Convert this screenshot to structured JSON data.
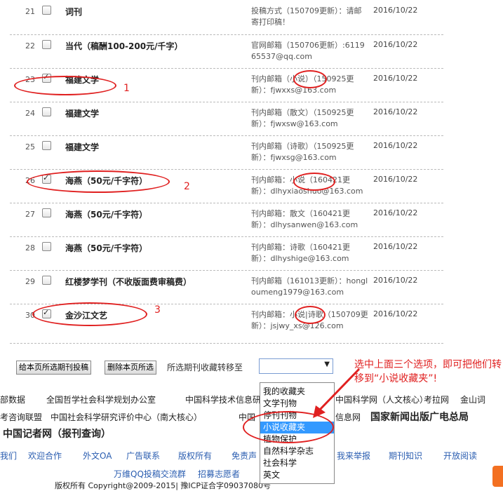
{
  "rows": [
    {
      "num": "21",
      "checked": false,
      "name": "词刊",
      "info": "投稿方式（150709更新）：请邮寄打印稿！",
      "date": "2016/10/22"
    },
    {
      "num": "22",
      "checked": false,
      "name": "当代（稿酬100-200元/千字）",
      "info": "官网邮箱（150706更新）:611965537@qq.com",
      "date": "2016/10/22"
    },
    {
      "num": "23",
      "checked": true,
      "name": "福建文学",
      "info": "刊内邮箱（小说）（150925更新）：fjwxxs@163.com",
      "date": "2016/10/22"
    },
    {
      "num": "24",
      "checked": false,
      "name": "福建文学",
      "info": "刊内邮箱（散文）（150925更新）：fjwxsw@163.com",
      "date": "2016/10/22"
    },
    {
      "num": "25",
      "checked": false,
      "name": "福建文学",
      "info": "刊内邮箱（诗歌）（150925更新）：fjwxsg@163.com",
      "date": "2016/10/22"
    },
    {
      "num": "26",
      "checked": true,
      "name": "海燕（50元/千字符）",
      "info": "刊内邮箱：小说（160421更新）：dlhyxiaoshuo@163.com",
      "date": "2016/10/22"
    },
    {
      "num": "27",
      "checked": false,
      "name": "海燕（50元/千字符）",
      "info": "刊内邮箱：散文（160421更新）：dlhysanwen@163.com",
      "date": "2016/10/22"
    },
    {
      "num": "28",
      "checked": false,
      "name": "海燕（50元/千字符）",
      "info": "刊内邮箱：诗歌（160421更新）：dlhyshige@163.com",
      "date": "2016/10/22"
    },
    {
      "num": "29",
      "checked": false,
      "name": "红楼梦学刊（不收版面费审稿费）",
      "info": "刊内邮箱（161013更新）：hongloumeng1979@163.com",
      "date": "2016/10/22"
    },
    {
      "num": "30",
      "checked": true,
      "name": "金沙江文艺",
      "info": "刊内邮箱：小说|诗歌（150709更新）：jsjwy_xs@126.com",
      "date": "2016/10/22"
    }
  ],
  "annotations": {
    "mark1": "1",
    "mark2": "2",
    "mark3": "3",
    "callout": "选中上面三个选项，即可把他们转移到“小说收藏夹”!"
  },
  "toolbar": {
    "submit_label": "给本页所选期刊投稿",
    "delete_label": "删除本页所选",
    "move_label": "所选期刊收藏转移至"
  },
  "dropdown": {
    "options": [
      "我的收藏夹",
      "文学刊物",
      "停刊刊物",
      "小说收藏夹",
      "植物保护",
      "自然科学杂志",
      "社会科学",
      "英文"
    ],
    "selected_index": 3
  },
  "footer": {
    "row1": [
      "部数据",
      "全国哲学社会科学规划办公室",
      "中国科学技术信息研",
      "中国科学网（人文核心）",
      "考拉网",
      "金山词"
    ],
    "row2": [
      "考咨询联盟",
      "中国社会科学研究评价中心（南大核心）",
      "中国",
      "信息网",
      "国家新闻出版广电总局"
    ],
    "row3": "中国记者网（报刊查询）",
    "row4": [
      "我们",
      "欢迎合作",
      "外文OA",
      "广告联系",
      "版权所有",
      "免责声",
      "我来举报",
      "期刊知识",
      "开放阅读"
    ],
    "row5": [
      "万维QQ投稿交流群",
      "招募志愿者"
    ],
    "row6": "版权所有 Copyright@2009-2015| 豫ICP证合字09037080号"
  },
  "colors": {
    "annotation": "#e02020",
    "link": "#2a5db0",
    "selected": "#3399ff"
  }
}
